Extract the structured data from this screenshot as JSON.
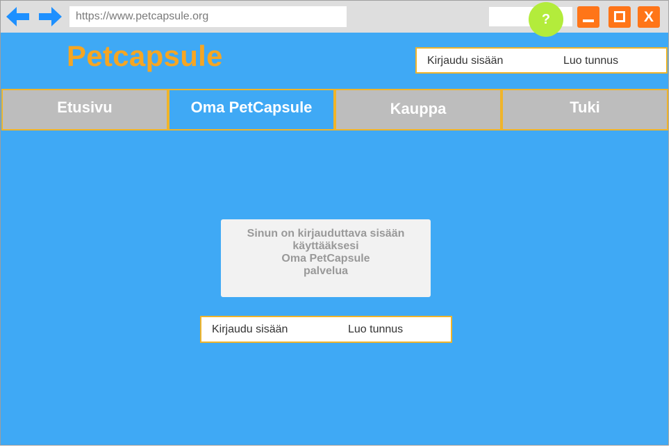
{
  "browser": {
    "url": "https://www.petcapsule.org",
    "help_label": "?",
    "close_label": "X"
  },
  "site": {
    "brand": "Petcapsule"
  },
  "header_auth": {
    "login_label": "Kirjaudu sisään",
    "register_label": "Luo tunnus"
  },
  "tabs": [
    {
      "label": "Etusivu",
      "active": false
    },
    {
      "label": "Oma PetCapsule",
      "active": true
    },
    {
      "label": "Kauppa",
      "active": false
    },
    {
      "label": "Tuki",
      "active": false
    }
  ],
  "notice": {
    "lines": [
      "Sinun on kirjauduttava sisään",
      "käyttääksesi",
      "Oma PetCapsule",
      "palvelua"
    ]
  },
  "main_auth": {
    "login_label": "Kirjaudu sisään",
    "register_label": "Luo tunnus"
  },
  "colors": {
    "page_background": "#3fa9f5",
    "brand": "#f5a623",
    "window_buttons": "#ff7518",
    "help_button": "#b3ec3b",
    "tab_inactive": "#bdbdbd",
    "border_accent": "#f0b429"
  },
  "icons": {
    "back": "arrow-left-icon",
    "forward": "arrow-right-icon",
    "minimize": "minimize-icon",
    "maximize": "maximize-icon",
    "close": "close-icon"
  }
}
